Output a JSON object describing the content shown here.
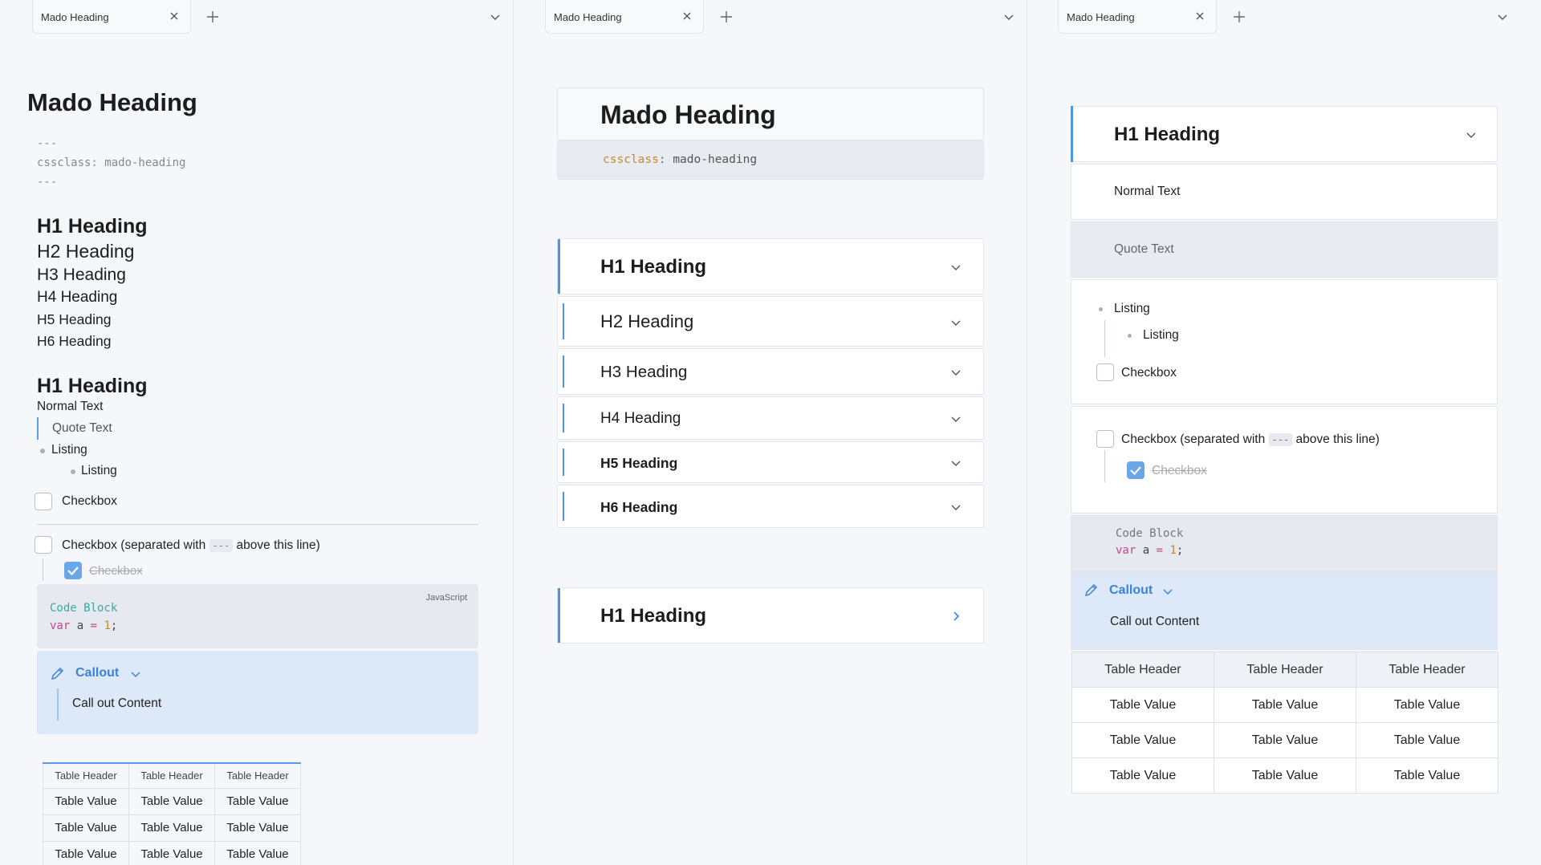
{
  "tabs": {
    "label": "Mado Heading"
  },
  "editor": {
    "title": "Mado Heading",
    "frontmatter": {
      "delimiter": "---",
      "line": "cssclass: mado-heading"
    },
    "headings": {
      "h1": "H1 Heading",
      "h2": "H2 Heading",
      "h3": "H3 Heading",
      "h4": "H4 Heading",
      "h5": "H5 Heading",
      "h6": "H6 Heading"
    },
    "normal_text": "Normal Text",
    "quote_text": "Quote Text",
    "listing": "Listing",
    "checkbox": "Checkbox",
    "checkbox_sep_before": "Checkbox (separated with",
    "checkbox_sep_code": "---",
    "checkbox_sep_after": "above this line)",
    "code": {
      "language": "JavaScript",
      "line1": "Code Block",
      "kw": "var",
      "name": " a ",
      "op": "=",
      "num": " 1",
      "end": ";"
    },
    "callout": {
      "title": "Callout",
      "content": "Call out Content"
    },
    "table": {
      "header": "Table Header",
      "value": "Table Value"
    }
  },
  "preview": {
    "title": "Mado Heading",
    "property_key": "cssclass",
    "property_sep": ": ",
    "property_value": "mado-heading"
  }
}
